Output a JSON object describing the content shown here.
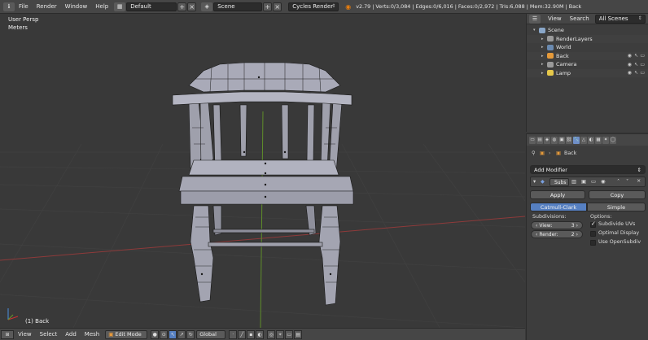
{
  "topbar": {
    "menus": [
      "File",
      "Render",
      "Window",
      "Help"
    ],
    "screen_layout": "Default",
    "scene_name": "Scene",
    "render_engine": "Cycles Render",
    "stats": "v2.79 | Verts:0/3,084 | Edges:0/6,016 | Faces:0/2,972 | Tris:6,088 | Mem:32.90M | Back"
  },
  "viewport": {
    "view_label": "User Persp",
    "units_label": "Meters",
    "object_label": "(1) Back"
  },
  "bottombar": {
    "menus": [
      "View",
      "Select",
      "Add",
      "Mesh"
    ],
    "mode": "Edit Mode",
    "orientation": "Global"
  },
  "outliner": {
    "menus": [
      "View",
      "Search"
    ],
    "filter": "All Scenes",
    "tree": [
      {
        "label": "Scene",
        "icon_color": "#8aa7c9",
        "indent": 0
      },
      {
        "label": "RenderLayers",
        "icon_color": "#9a9a9a",
        "indent": 1
      },
      {
        "label": "World",
        "icon_color": "#6a8ab0",
        "indent": 1
      },
      {
        "label": "Back",
        "icon_color": "#e59a3a",
        "indent": 1
      },
      {
        "label": "Camera",
        "icon_color": "#9a9a9a",
        "indent": 1
      },
      {
        "label": "Lamp",
        "icon_color": "#e6c84a",
        "indent": 1
      }
    ]
  },
  "properties": {
    "object_name": "Back",
    "add_modifier_label": "Add Modifier",
    "modifier_name": "Subs",
    "apply_label": "Apply",
    "copy_label": "Copy",
    "algorithm_options": [
      "Catmull-Clark",
      "Simple"
    ],
    "active_algorithm": "Catmull-Clark",
    "subdivisions_label": "Subdivisions:",
    "options_label": "Options:",
    "view_label": "View:",
    "view_value": "3",
    "render_label": "Render:",
    "render_value": "2",
    "checkboxes": [
      {
        "label": "Subdivide UVs",
        "checked": true
      },
      {
        "label": "Optimal Display",
        "checked": false
      },
      {
        "label": "Use OpenSubdiv",
        "checked": false
      }
    ]
  },
  "colors": {
    "accent": "#5680c2",
    "axis_red": "#9b3b3b",
    "axis_green": "#6b8e23",
    "mesh_face": "#b8b8c4",
    "mesh_edge": "#1a1a1a"
  }
}
